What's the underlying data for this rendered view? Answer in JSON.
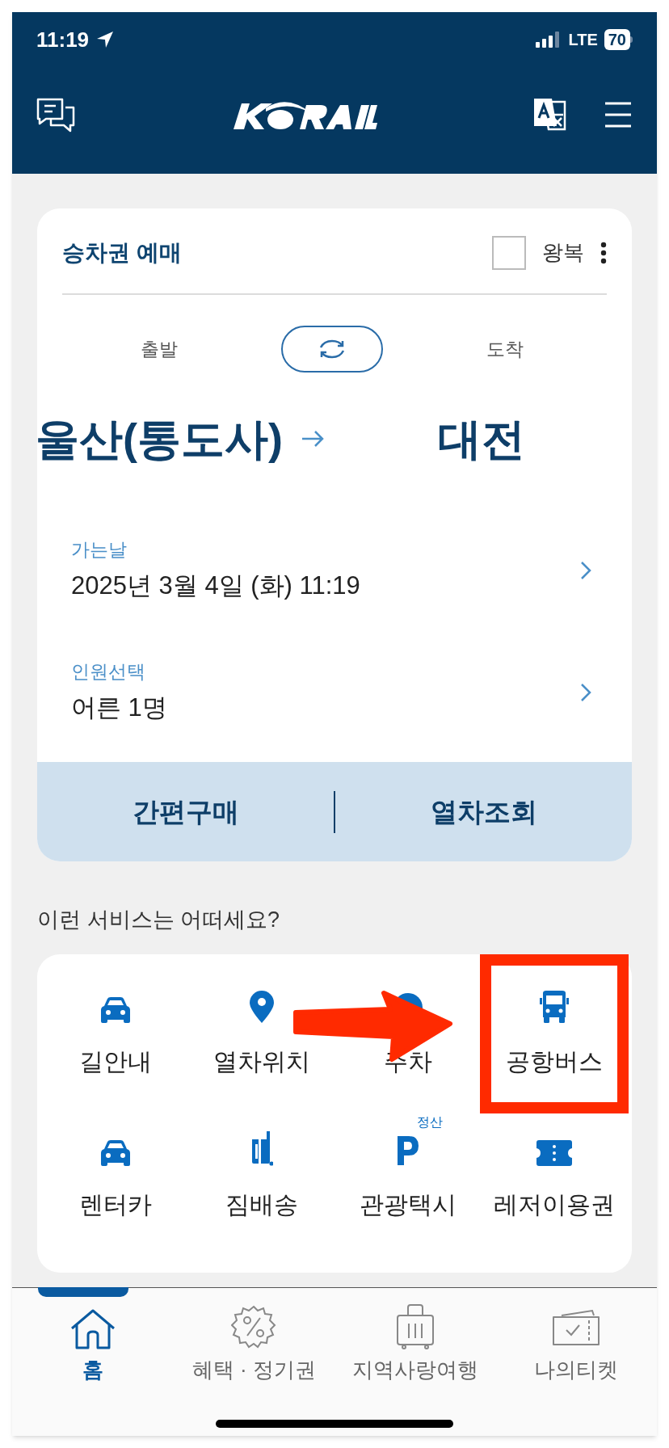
{
  "status_bar": {
    "time": "11:19",
    "network": "LTE",
    "battery": "70"
  },
  "booking": {
    "title": "승차권 예매",
    "round_trip": {
      "label": "왕복",
      "checked": false
    },
    "departure_label": "출발",
    "arrival_label": "도착",
    "departure": "울산(통도사)",
    "arrival": "대전",
    "date": {
      "label": "가는날",
      "value": "2025년 3월 4일 (화) 11:19"
    },
    "passengers": {
      "label": "인원선택",
      "value": "어른 1명"
    },
    "actions": [
      "간편구매",
      "열차조회"
    ]
  },
  "services": {
    "title": "이런 서비스는 어떠세요?",
    "items": [
      {
        "label": "길안내"
      },
      {
        "label": "열차위치"
      },
      {
        "label": "주차"
      },
      {
        "label": "공항버스"
      },
      {
        "label": "렌터카"
      },
      {
        "label": "짐배송"
      },
      {
        "label": "관광택시",
        "badge": "정산"
      },
      {
        "label": "레저이용권"
      }
    ]
  },
  "tab_bar": [
    {
      "label": "홈",
      "selected": true
    },
    {
      "label": "혜택 · 정기권",
      "selected": false
    },
    {
      "label": "지역사랑여행",
      "selected": false
    },
    {
      "label": "나의티켓",
      "selected": false
    }
  ]
}
